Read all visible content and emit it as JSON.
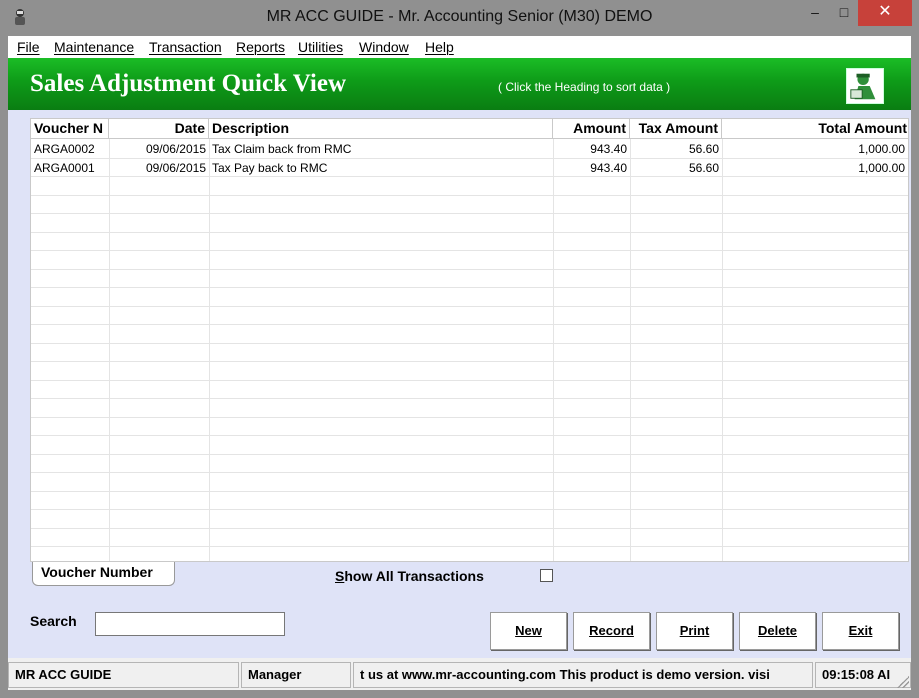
{
  "window": {
    "title": "MR ACC GUIDE - Mr. Accounting Senior (M30) DEMO",
    "min_glyph": "–",
    "max_glyph": "□",
    "close_glyph": "✕"
  },
  "menu": [
    {
      "label": "File"
    },
    {
      "label": "Maintenance"
    },
    {
      "label": "Transaction"
    },
    {
      "label": "Reports"
    },
    {
      "label": "Utilities"
    },
    {
      "label": "Window"
    },
    {
      "label": "Help"
    }
  ],
  "header": {
    "title": "Sales Adjustment Quick View",
    "hint": "( Click the Heading to sort data )",
    "icon": "accountant-figure-icon"
  },
  "grid": {
    "columns": [
      "Voucher N",
      "Date",
      "Description",
      "Amount",
      "Tax Amount",
      "Total Amount"
    ],
    "rows": [
      [
        "ARGA0002",
        "09/06/2015",
        "Tax Claim back from RMC",
        "943.40",
        "56.60",
        "1,000.00"
      ],
      [
        "ARGA0001",
        "09/06/2015",
        "Tax Pay back to RMC",
        "943.40",
        "56.60",
        "1,000.00"
      ]
    ]
  },
  "tab": {
    "label": "Voucher Number"
  },
  "show_all": {
    "label_u": "S",
    "label_rest": "how All Transactions",
    "checked": false
  },
  "search": {
    "label": "Search",
    "value": ""
  },
  "buttons": {
    "new": "New",
    "record": "Record",
    "print": "Print",
    "delete": "Delete",
    "exit": "Exit"
  },
  "status": {
    "app": "MR ACC GUIDE",
    "user": "Manager",
    "message": "t us at www.mr-accounting.com This product is demo version.  visi",
    "time": "09:15:08 AI"
  },
  "colors": {
    "header_green": "#0e9b18",
    "close_red": "#c7413a",
    "client_bg": "#dfe3f7"
  }
}
